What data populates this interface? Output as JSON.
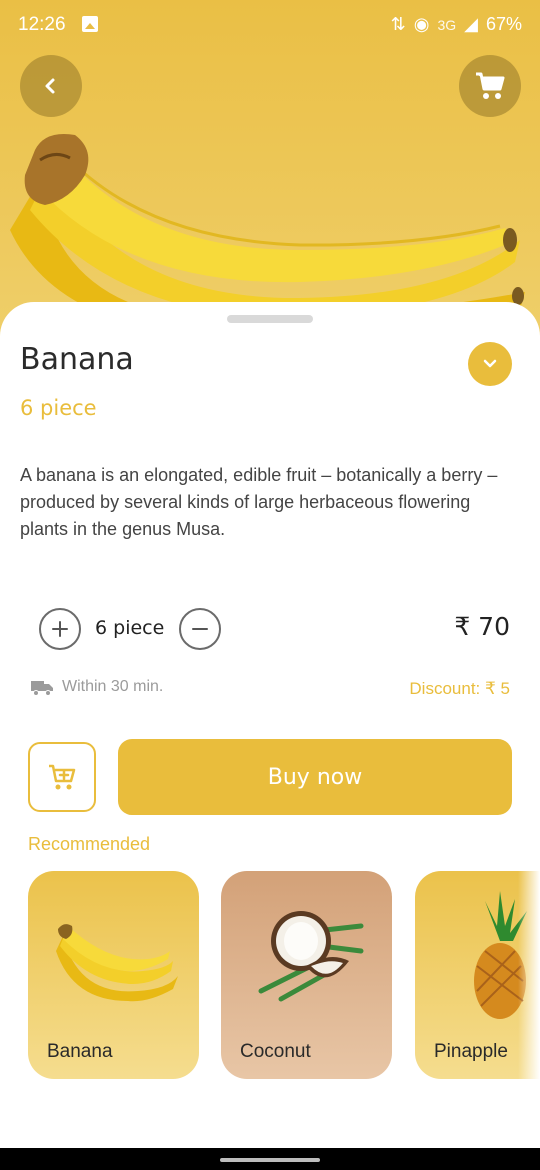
{
  "status_bar": {
    "time": "12:26",
    "network": "3G",
    "battery": "67%"
  },
  "product": {
    "name": "Banana",
    "unit": "6 piece",
    "description": "A banana is an elongated, edible fruit – botanically a berry – produced by several kinds of large herbaceous flowering plants in the genus Musa.",
    "quantity": "6 piece",
    "price": "₹ 70",
    "delivery": "Within 30 min.",
    "discount": "Discount: ₹ 5"
  },
  "actions": {
    "buy_label": "Buy now"
  },
  "recommended": {
    "title": "Recommended",
    "items": [
      {
        "label": "Banana"
      },
      {
        "label": "Coconut"
      },
      {
        "label": "Pinapple"
      }
    ]
  },
  "colors": {
    "accent": "#e9bd3c",
    "hero_bg": "#ecc450",
    "coconut_card": "#d9ab84"
  },
  "icons": [
    "back-icon",
    "cart-icon",
    "chevron-down-icon",
    "plus-icon",
    "minus-icon",
    "truck-icon",
    "add-to-cart-icon"
  ]
}
